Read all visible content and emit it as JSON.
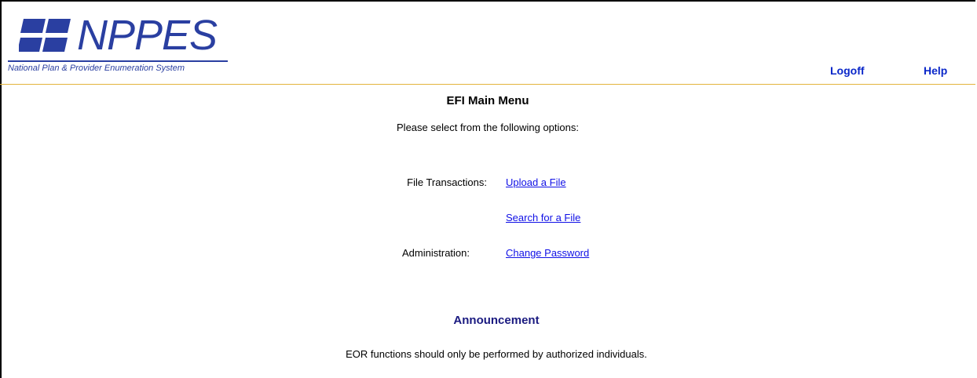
{
  "header": {
    "logo_word": "NPPES",
    "logo_tagline": "National Plan & Provider Enumeration System",
    "brand_color": "#2a3fa1",
    "nav": {
      "logoff_label": "Logoff",
      "help_label": "Help"
    }
  },
  "main": {
    "title": "EFI Main Menu",
    "subtitle": "Please select from the following options:",
    "menu": {
      "file_transactions_label": "File Transactions:",
      "upload_link": "Upload a File",
      "search_link": "Search for a File",
      "administration_label": "Administration:",
      "change_password_link": "Change Password"
    }
  },
  "announcement": {
    "title": "Announcement",
    "text": "EOR functions should only be performed by authorized individuals."
  }
}
